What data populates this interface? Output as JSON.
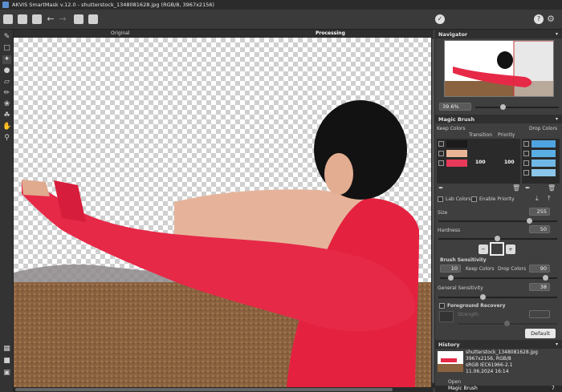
{
  "window": {
    "title": "AKVIS SmartMask v.12.0 - shutterstock_1348081628.jpg (RGB/8, 3967x2156)"
  },
  "canvas": {
    "original_label": "Original",
    "processing_label": "Processing"
  },
  "navigator": {
    "title": "Navigator",
    "zoom": "39.6%"
  },
  "magic_brush": {
    "title": "Magic Brush",
    "keep_colors": "Keep Colors",
    "transition": "Transition",
    "priority": "Priority",
    "drop_colors": "Drop Colors",
    "keep_rows": [
      {
        "color": "#1b1b1b",
        "transition": "",
        "priority": ""
      },
      {
        "color": "#e8b397",
        "transition": "",
        "priority": ""
      },
      {
        "color": "#e8395a",
        "transition": "100",
        "priority": "100"
      }
    ],
    "drop_rows": [
      "#4fa3e0",
      "#5aaee4",
      "#6fb8e6",
      "#8cc6ea"
    ],
    "lab_colors": "Lab Colors",
    "enable_priority": "Enable Priority",
    "size_label": "Size",
    "size_value": "255",
    "hardness_label": "Hardness",
    "hardness_value": "50",
    "brush_sensitivity": "Brush Sensitivity",
    "keep_sens": "10",
    "keep_colors_lbl": "Keep Colors",
    "drop_colors_lbl": "Drop Colors",
    "drop_sens": "90",
    "general_sensitivity": "General Sensitivity",
    "general_value": "38",
    "fg_recovery": "Foreground Recovery",
    "strength": "Strength",
    "default_btn": "Default"
  },
  "history": {
    "title": "History",
    "file": "shutterstock_1348081628.jpg",
    "line2": "3967x2156, RGB/8",
    "line3": "sRGB IEC61966-2.1",
    "line4": "11.06.2024 16:14",
    "items": [
      "Open",
      "Magic Brush"
    ],
    "count": "7"
  }
}
